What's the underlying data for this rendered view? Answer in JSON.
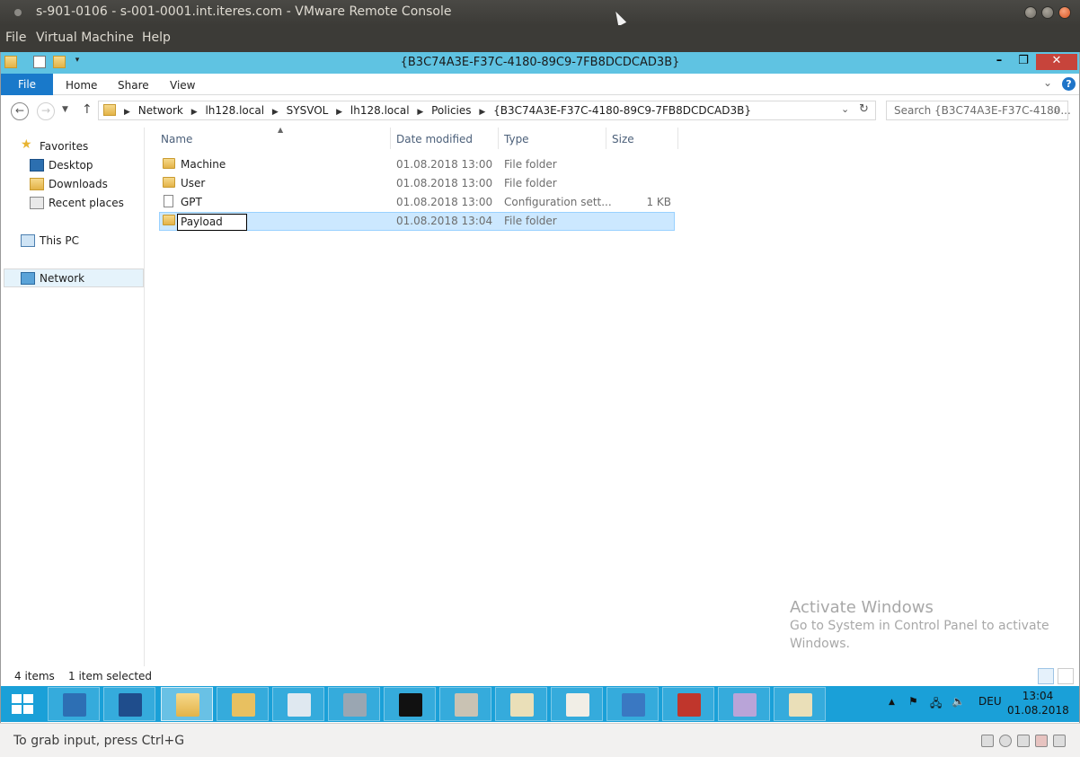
{
  "vmware": {
    "window_title": "s-901-0106 - s-001-0001.int.iteres.com - VMware Remote Console",
    "menu": [
      "File",
      "Virtual Machine",
      "Help"
    ],
    "status_hint": "To grab input, press Ctrl+G"
  },
  "explorer": {
    "title": "{B3C74A3E-F37C-4180-89C9-7FB8DCDCAD3B}",
    "ribbon_tabs": {
      "file": "File",
      "home": "Home",
      "share": "Share",
      "view": "View"
    },
    "breadcrumb": [
      "Network",
      "lh128.local",
      "SYSVOL",
      "lh128.local",
      "Policies",
      "{B3C74A3E-F37C-4180-89C9-7FB8DCDCAD3B}"
    ],
    "search_placeholder": "Search {B3C74A3E-F37C-4180...",
    "nav": {
      "favorites": "Favorites",
      "desktop": "Desktop",
      "downloads": "Downloads",
      "recent": "Recent places",
      "thispc": "This PC",
      "network": "Network"
    },
    "columns": {
      "name": "Name",
      "date": "Date modified",
      "type": "Type",
      "size": "Size"
    },
    "files": [
      {
        "name": "Machine",
        "date": "01.08.2018 13:00",
        "type": "File folder",
        "size": ""
      },
      {
        "name": "User",
        "date": "01.08.2018 13:00",
        "type": "File folder",
        "size": ""
      },
      {
        "name": "GPT",
        "date": "01.08.2018 13:00",
        "type": "Configuration sett...",
        "size": "1 KB"
      },
      {
        "name": "Payload",
        "date": "01.08.2018 13:04",
        "type": "File folder",
        "size": ""
      }
    ],
    "status": {
      "count": "4 items",
      "selected": "1 item selected"
    }
  },
  "watermark": {
    "heading": "Activate Windows",
    "text": "Go to System in Control Panel to activate Windows."
  },
  "taskbar": {
    "language": "DEU",
    "time": "13:04",
    "date": "01.08.2018"
  },
  "colors": {
    "caption": "#5fc3e2",
    "taskbar": "#1aa0d8",
    "file_tab": "#1979ca",
    "selection": "#cce8ff"
  }
}
